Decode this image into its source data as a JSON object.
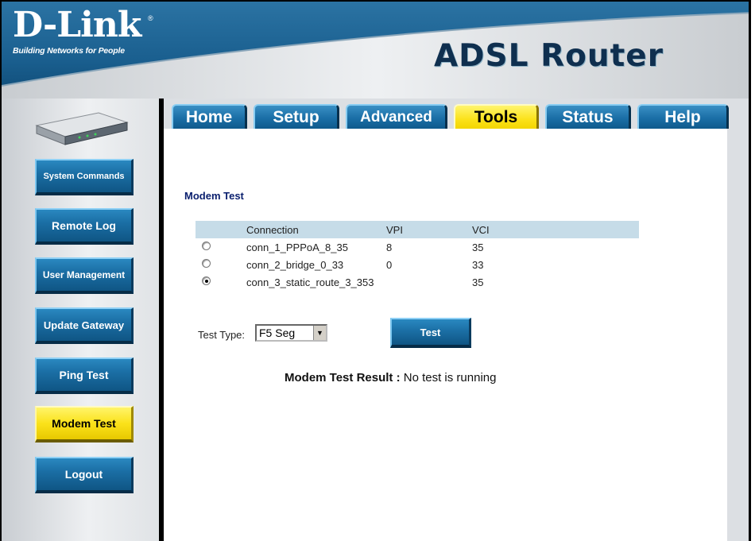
{
  "brand": {
    "logo": "D-Link",
    "registered": "®",
    "tagline": "Building Networks for People",
    "product": "ADSL Router"
  },
  "tabs": [
    {
      "label": "Home",
      "active": false
    },
    {
      "label": "Setup",
      "active": false
    },
    {
      "label": "Advanced",
      "active": false
    },
    {
      "label": "Tools",
      "active": true
    },
    {
      "label": "Status",
      "active": false
    },
    {
      "label": "Help",
      "active": false
    }
  ],
  "sidebar": {
    "items": [
      {
        "label": "System Commands",
        "active": false
      },
      {
        "label": "Remote Log",
        "active": false
      },
      {
        "label": "User Management",
        "active": false
      },
      {
        "label": "Update Gateway",
        "active": false
      },
      {
        "label": "Ping Test",
        "active": false
      },
      {
        "label": "Modem Test",
        "active": true
      },
      {
        "label": "Logout",
        "active": false
      }
    ]
  },
  "main": {
    "title": "Modem Test",
    "table": {
      "headers": [
        "Connection",
        "VPI",
        "VCI"
      ],
      "rows": [
        {
          "connection": "conn_1_PPPoA_8_35",
          "vpi": "8",
          "vci": "35",
          "selected": false
        },
        {
          "connection": "conn_2_bridge_0_33",
          "vpi": "0",
          "vci": "33",
          "selected": false
        },
        {
          "connection": "conn_3_static_route_3_353",
          "vpi": "",
          "vci": "35",
          "selected": true
        }
      ]
    },
    "test_type_label": "Test Type:",
    "test_type_value": "F5 Seg",
    "test_button": "Test",
    "result_label": "Modem Test Result :",
    "result_value": "No test is running"
  },
  "colors": {
    "accent_blue": "#1b6fa5",
    "active_yellow": "#fbe21a",
    "title_navy": "#0a1f6e",
    "table_header": "#c6dce8"
  }
}
